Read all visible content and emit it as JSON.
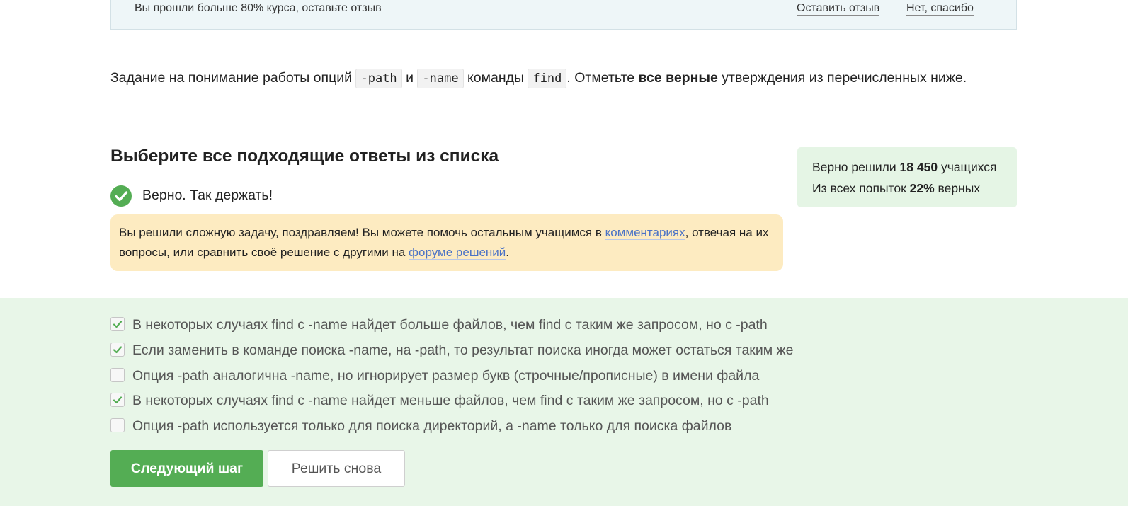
{
  "review_banner": {
    "text": "Вы прошли больше 80% курса, оставьте отзыв",
    "leave_review_label": "Оставить отзыв",
    "decline_label": "Нет, спасибо"
  },
  "task": {
    "prefix": "Задание на понимание работы опций",
    "code_path": "-path",
    "and": "и",
    "code_name": "-name",
    "command_word": "команды",
    "code_find": "find",
    "mark_text": ". Отметьте",
    "bold_text": "все верные",
    "suffix": "утверждения из перечисленных ниже."
  },
  "quiz": {
    "heading": "Выберите все подходящие ответы из списка",
    "verdict": "Верно. Так держать!",
    "hint": {
      "part1": "Вы решили сложную задачу, поздравляем! Вы можете помочь остальным учащимся в",
      "link_comments": "комментариях",
      "part2": ", отвечая на их вопросы, или сравнить своё решение с другими на",
      "link_forum": "форуме решений",
      "part3": "."
    }
  },
  "stats": {
    "solved_prefix": "Верно решили",
    "solved_count": "18 450",
    "solved_suffix": "учащихся",
    "attempts_prefix": "Из всех попыток",
    "attempts_percent": "22%",
    "attempts_suffix": "верных"
  },
  "options": [
    {
      "label": "В некоторых случаях find c -name найдет больше файлов, чем find с таким же запросом, но с -path",
      "checked": true
    },
    {
      "label": "Если заменить в команде поиска -name, на -path, то результат поиска иногда может остаться таким же",
      "checked": true
    },
    {
      "label": "Опция -path аналогична -name, но игнорирует размер букв (строчные/прописные) в имени файла",
      "checked": false
    },
    {
      "label": "В некоторых случаях find c -name найдет меньше файлов, чем find с таким же запросом, но с -path",
      "checked": true
    },
    {
      "label": "Опция -path используется только для поиска директорий, а -name только для поиска файлов",
      "checked": false
    }
  ],
  "buttons": {
    "next_label": "Следующий шаг",
    "retry_label": "Решить снова"
  },
  "colors": {
    "accent_green": "#54ad54",
    "answers_background": "#e8f6e8",
    "hint_background": "#fdebc1",
    "link_blue": "#4a72c6"
  }
}
